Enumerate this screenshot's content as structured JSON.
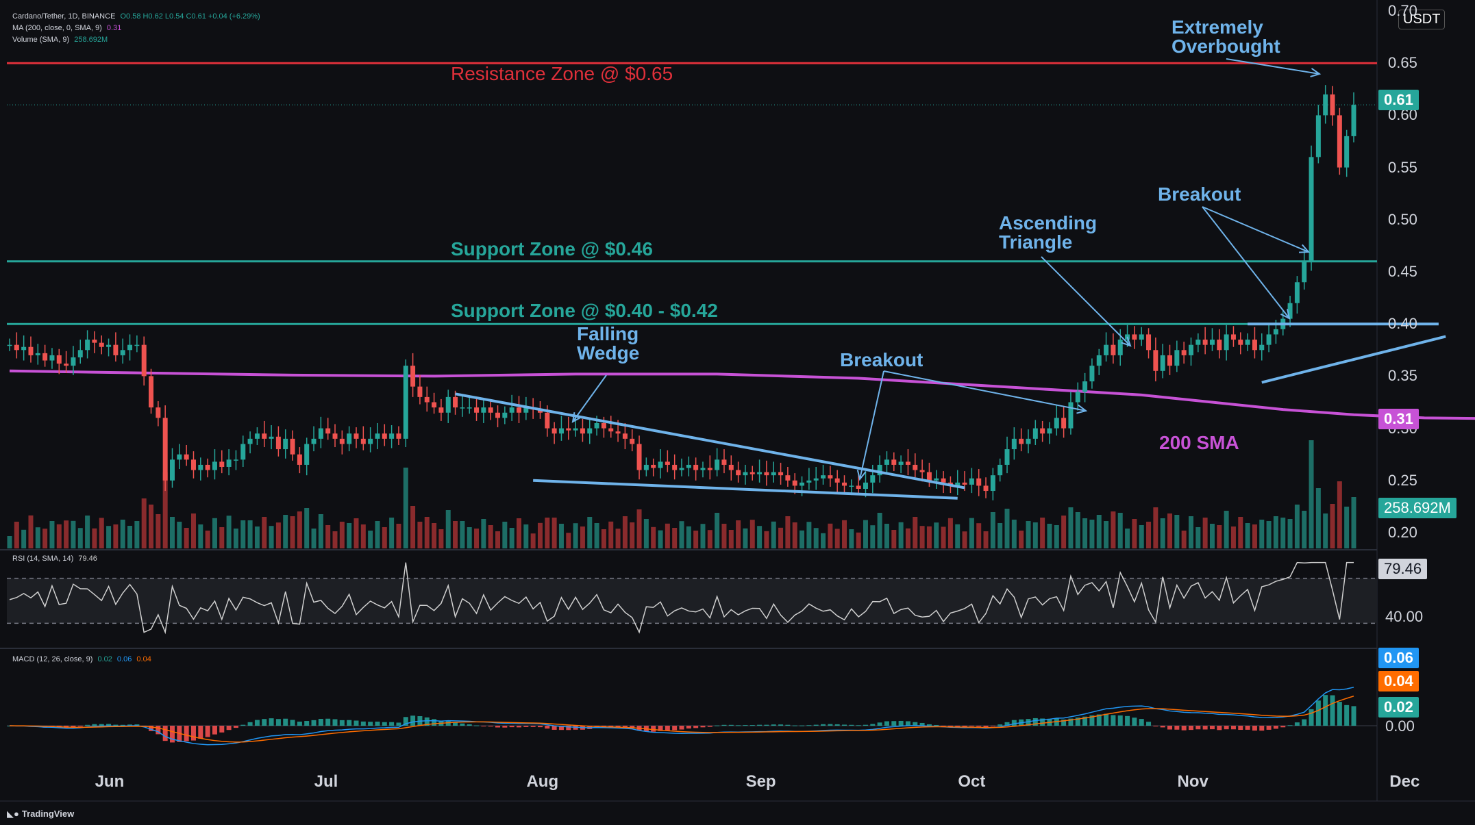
{
  "header": {
    "symbol": "Cardano/Tether, 1D, BINANCE",
    "ohlc": "O0.58 H0.62 L0.54 C0.61 +0.04 (+6.29%)",
    "ma_label": "MA (200, close, 0, SMA, 9)",
    "ma_value": "0.31",
    "vol_label": "Volume (SMA, 9)",
    "vol_value": "258.692M",
    "currency": "USDT"
  },
  "rsi": {
    "label": "RSI (14, SMA, 14)",
    "value": "79.46",
    "axis_40": "40.00",
    "upper": 70,
    "lower": 30
  },
  "macd": {
    "label": "MACD (12, 26, close, 9)",
    "v1": "0.02",
    "v2": "0.06",
    "v3": "0.04",
    "tag_macd": "0.06",
    "tag_signal": "0.04",
    "tag_hist": "0.02",
    "axis_zero": "0.00"
  },
  "tags": {
    "price": "0.61",
    "sma": "0.31",
    "volume": "258.692M"
  },
  "annotations": {
    "resistance": "Resistance Zone @ $0.65",
    "support1": "Support Zone @ $0.46",
    "support2": "Support Zone @ $0.40 - $0.42",
    "falling_wedge_1": "Falling",
    "falling_wedge_2": "Wedge",
    "breakout_1": "Breakout",
    "ascending_1": "Ascending",
    "ascending_2": "Triangle",
    "breakout_2": "Breakout",
    "overbought_1": "Extremely",
    "overbought_2": "Overbought",
    "sma200": "200 SMA"
  },
  "colors": {
    "up": "#26a69a",
    "down": "#ef5350",
    "sma": "#c752d6",
    "resistance": "#e0303a",
    "support": "#26a69a",
    "annot": "#6fb3ea",
    "rsi": "#cfcfcf",
    "macd": "#2196f3",
    "signal": "#ff6d00"
  },
  "brand": "TradingView",
  "chart_data": {
    "type": "candlestick",
    "price_axis": [
      "0.70",
      "0.65",
      "0.60",
      "0.55",
      "0.50",
      "0.45",
      "0.40",
      "0.35",
      "0.30",
      "0.25",
      "0.20"
    ],
    "ylim": [
      0.2,
      0.7
    ],
    "x_labels": [
      "Jun",
      "Jul",
      "Aug",
      "Sep",
      "Oct",
      "Nov",
      "Dec"
    ],
    "levels": {
      "resistance": 0.65,
      "support_high": 0.46,
      "support_low": 0.4,
      "last_close": 0.61
    },
    "sma200": [
      [
        0,
        0.355
      ],
      [
        20,
        0.353
      ],
      [
        40,
        0.351
      ],
      [
        60,
        0.35
      ],
      [
        80,
        0.352
      ],
      [
        100,
        0.352
      ],
      [
        120,
        0.348
      ],
      [
        140,
        0.34
      ],
      [
        160,
        0.332
      ],
      [
        170,
        0.325
      ],
      [
        180,
        0.318
      ],
      [
        190,
        0.313
      ],
      [
        200,
        0.31
      ],
      [
        214,
        0.309
      ]
    ],
    "candles": [
      [
        0.38,
        0.38
      ],
      [
        0.38,
        0.375
      ],
      [
        0.375,
        0.378
      ],
      [
        0.378,
        0.37
      ],
      [
        0.37,
        0.372
      ],
      [
        0.372,
        0.365
      ],
      [
        0.365,
        0.37
      ],
      [
        0.37,
        0.362
      ],
      [
        0.362,
        0.36
      ],
      [
        0.36,
        0.368
      ],
      [
        0.368,
        0.375
      ],
      [
        0.375,
        0.385
      ],
      [
        0.385,
        0.382
      ],
      [
        0.382,
        0.378
      ],
      [
        0.378,
        0.38
      ],
      [
        0.38,
        0.37
      ],
      [
        0.37,
        0.375
      ],
      [
        0.375,
        0.38
      ],
      [
        0.38,
        0.38
      ],
      [
        0.38,
        0.35
      ],
      [
        0.35,
        0.32
      ],
      [
        0.32,
        0.31
      ],
      [
        0.31,
        0.25
      ],
      [
        0.25,
        0.27
      ],
      [
        0.27,
        0.275
      ],
      [
        0.275,
        0.27
      ],
      [
        0.27,
        0.26
      ],
      [
        0.26,
        0.265
      ],
      [
        0.265,
        0.26
      ],
      [
        0.26,
        0.268
      ],
      [
        0.268,
        0.263
      ],
      [
        0.263,
        0.27
      ],
      [
        0.27,
        0.27
      ],
      [
        0.27,
        0.285
      ],
      [
        0.285,
        0.29
      ],
      [
        0.29,
        0.295
      ],
      [
        0.295,
        0.29
      ],
      [
        0.29,
        0.292
      ],
      [
        0.292,
        0.28
      ],
      [
        0.28,
        0.29
      ],
      [
        0.29,
        0.275
      ],
      [
        0.275,
        0.265
      ],
      [
        0.265,
        0.285
      ],
      [
        0.285,
        0.29
      ],
      [
        0.29,
        0.3
      ],
      [
        0.3,
        0.295
      ],
      [
        0.295,
        0.29
      ],
      [
        0.29,
        0.285
      ],
      [
        0.285,
        0.295
      ],
      [
        0.295,
        0.29
      ],
      [
        0.29,
        0.285
      ],
      [
        0.285,
        0.29
      ],
      [
        0.29,
        0.295
      ],
      [
        0.295,
        0.29
      ],
      [
        0.29,
        0.295
      ],
      [
        0.295,
        0.29
      ],
      [
        0.29,
        0.36
      ],
      [
        0.36,
        0.34
      ],
      [
        0.34,
        0.33
      ],
      [
        0.33,
        0.325
      ],
      [
        0.325,
        0.32
      ],
      [
        0.32,
        0.315
      ],
      [
        0.315,
        0.33
      ],
      [
        0.33,
        0.32
      ],
      [
        0.32,
        0.32
      ],
      [
        0.32,
        0.32
      ],
      [
        0.32,
        0.315
      ],
      [
        0.315,
        0.32
      ],
      [
        0.32,
        0.315
      ],
      [
        0.315,
        0.31
      ],
      [
        0.31,
        0.315
      ],
      [
        0.315,
        0.32
      ],
      [
        0.32,
        0.315
      ],
      [
        0.315,
        0.32
      ],
      [
        0.32,
        0.318
      ],
      [
        0.318,
        0.315
      ],
      [
        0.315,
        0.3
      ],
      [
        0.3,
        0.295
      ],
      [
        0.295,
        0.3
      ],
      [
        0.3,
        0.298
      ],
      [
        0.298,
        0.3
      ],
      [
        0.3,
        0.295
      ],
      [
        0.295,
        0.3
      ],
      [
        0.3,
        0.305
      ],
      [
        0.305,
        0.3
      ],
      [
        0.3,
        0.297
      ],
      [
        0.297,
        0.295
      ],
      [
        0.295,
        0.29
      ],
      [
        0.29,
        0.285
      ],
      [
        0.285,
        0.26
      ],
      [
        0.26,
        0.265
      ],
      [
        0.265,
        0.262
      ],
      [
        0.262,
        0.268
      ],
      [
        0.268,
        0.265
      ],
      [
        0.265,
        0.26
      ],
      [
        0.26,
        0.262
      ],
      [
        0.262,
        0.265
      ],
      [
        0.265,
        0.26
      ],
      [
        0.26,
        0.262
      ],
      [
        0.262,
        0.26
      ],
      [
        0.26,
        0.27
      ],
      [
        0.27,
        0.265
      ],
      [
        0.265,
        0.26
      ],
      [
        0.26,
        0.255
      ],
      [
        0.255,
        0.258
      ],
      [
        0.258,
        0.256
      ],
      [
        0.256,
        0.258
      ],
      [
        0.258,
        0.255
      ],
      [
        0.255,
        0.258
      ],
      [
        0.258,
        0.255
      ],
      [
        0.255,
        0.25
      ],
      [
        0.25,
        0.245
      ],
      [
        0.245,
        0.248
      ],
      [
        0.248,
        0.25
      ],
      [
        0.25,
        0.252
      ],
      [
        0.252,
        0.255
      ],
      [
        0.255,
        0.252
      ],
      [
        0.252,
        0.248
      ],
      [
        0.248,
        0.245
      ],
      [
        0.245,
        0.245
      ],
      [
        0.245,
        0.242
      ],
      [
        0.242,
        0.248
      ],
      [
        0.248,
        0.255
      ],
      [
        0.255,
        0.265
      ],
      [
        0.265,
        0.27
      ],
      [
        0.27,
        0.265
      ],
      [
        0.265,
        0.268
      ],
      [
        0.268,
        0.265
      ],
      [
        0.265,
        0.26
      ],
      [
        0.26,
        0.258
      ],
      [
        0.258,
        0.25
      ],
      [
        0.25,
        0.252
      ],
      [
        0.252,
        0.248
      ],
      [
        0.248,
        0.245
      ],
      [
        0.245,
        0.248
      ],
      [
        0.248,
        0.246
      ],
      [
        0.246,
        0.252
      ],
      [
        0.252,
        0.245
      ],
      [
        0.245,
        0.24
      ],
      [
        0.24,
        0.255
      ],
      [
        0.255,
        0.265
      ],
      [
        0.265,
        0.28
      ],
      [
        0.28,
        0.29
      ],
      [
        0.29,
        0.285
      ],
      [
        0.285,
        0.29
      ],
      [
        0.29,
        0.3
      ],
      [
        0.3,
        0.295
      ],
      [
        0.295,
        0.3
      ],
      [
        0.3,
        0.31
      ],
      [
        0.31,
        0.3
      ],
      [
        0.3,
        0.325
      ],
      [
        0.325,
        0.335
      ],
      [
        0.335,
        0.345
      ],
      [
        0.345,
        0.36
      ],
      [
        0.36,
        0.37
      ],
      [
        0.37,
        0.38
      ],
      [
        0.38,
        0.37
      ],
      [
        0.37,
        0.385
      ],
      [
        0.385,
        0.39
      ],
      [
        0.39,
        0.385
      ],
      [
        0.385,
        0.39
      ],
      [
        0.39,
        0.375
      ],
      [
        0.375,
        0.355
      ],
      [
        0.355,
        0.37
      ],
      [
        0.37,
        0.36
      ],
      [
        0.36,
        0.375
      ],
      [
        0.375,
        0.37
      ],
      [
        0.37,
        0.38
      ],
      [
        0.38,
        0.385
      ],
      [
        0.385,
        0.38
      ],
      [
        0.38,
        0.385
      ],
      [
        0.385,
        0.375
      ],
      [
        0.375,
        0.39
      ],
      [
        0.39,
        0.385
      ],
      [
        0.385,
        0.38
      ],
      [
        0.38,
        0.385
      ],
      [
        0.385,
        0.375
      ],
      [
        0.375,
        0.38
      ],
      [
        0.38,
        0.39
      ],
      [
        0.39,
        0.395
      ],
      [
        0.395,
        0.405
      ],
      [
        0.405,
        0.42
      ],
      [
        0.42,
        0.44
      ],
      [
        0.44,
        0.46
      ],
      [
        0.46,
        0.56
      ],
      [
        0.56,
        0.6
      ],
      [
        0.6,
        0.62
      ],
      [
        0.62,
        0.6
      ],
      [
        0.6,
        0.55
      ],
      [
        0.55,
        0.58
      ],
      [
        0.58,
        0.61
      ]
    ]
  }
}
